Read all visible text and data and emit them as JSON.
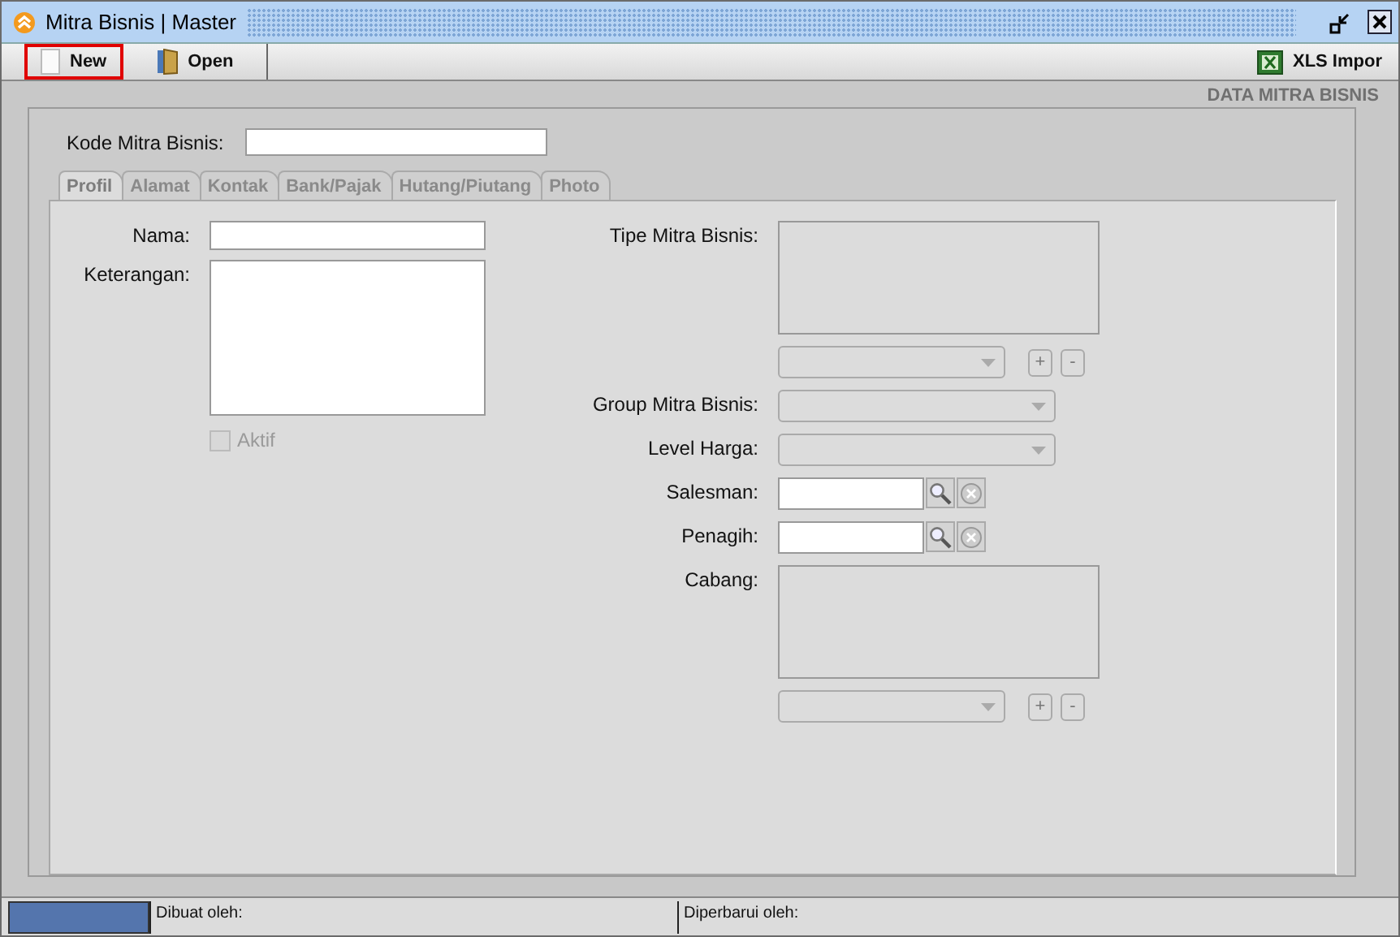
{
  "window": {
    "title": "Mitra Bisnis | Master"
  },
  "toolbar": {
    "buttons": [
      {
        "label": "New",
        "focused": true
      },
      {
        "label": "Open",
        "focused": false
      }
    ],
    "right_button": {
      "label": "XLS Impor"
    }
  },
  "heading": "DATA MITRA BISNIS",
  "kode": {
    "label": "Kode Mitra Bisnis:"
  },
  "tabs": [
    {
      "label": "Profil",
      "selected": true
    },
    {
      "label": "Alamat",
      "selected": false
    },
    {
      "label": "Kontak",
      "selected": false
    },
    {
      "label": "Bank/Pajak",
      "selected": false
    },
    {
      "label": "Hutang/Piutang",
      "selected": false
    },
    {
      "label": "Photo",
      "selected": false
    }
  ],
  "left_fields": [
    {
      "kind": "text",
      "label": "Nama:"
    },
    {
      "kind": "textarea",
      "label": "Keterangan:"
    }
  ],
  "aktif": {
    "label": "Aktif",
    "checked": false,
    "disabled": true
  },
  "right_fields": [
    {
      "kind": "list",
      "label": "Tipe Mitra Bisnis:",
      "disabled": true,
      "add": "+",
      "remove": "-"
    },
    {
      "kind": "combo",
      "label": "Group Mitra Bisnis:",
      "disabled": true
    },
    {
      "kind": "combo",
      "label": "Level Harga:",
      "disabled": true
    },
    {
      "kind": "lookup",
      "label": "Salesman:",
      "disabled": false
    },
    {
      "kind": "lookup",
      "label": "Penagih:",
      "disabled": false
    },
    {
      "kind": "list",
      "label": "Cabang:",
      "disabled": true,
      "add": "+",
      "remove": "-"
    }
  ],
  "status_bar": {
    "created": "Dibuat oleh:",
    "updated": "Diperbarui oleh:"
  }
}
